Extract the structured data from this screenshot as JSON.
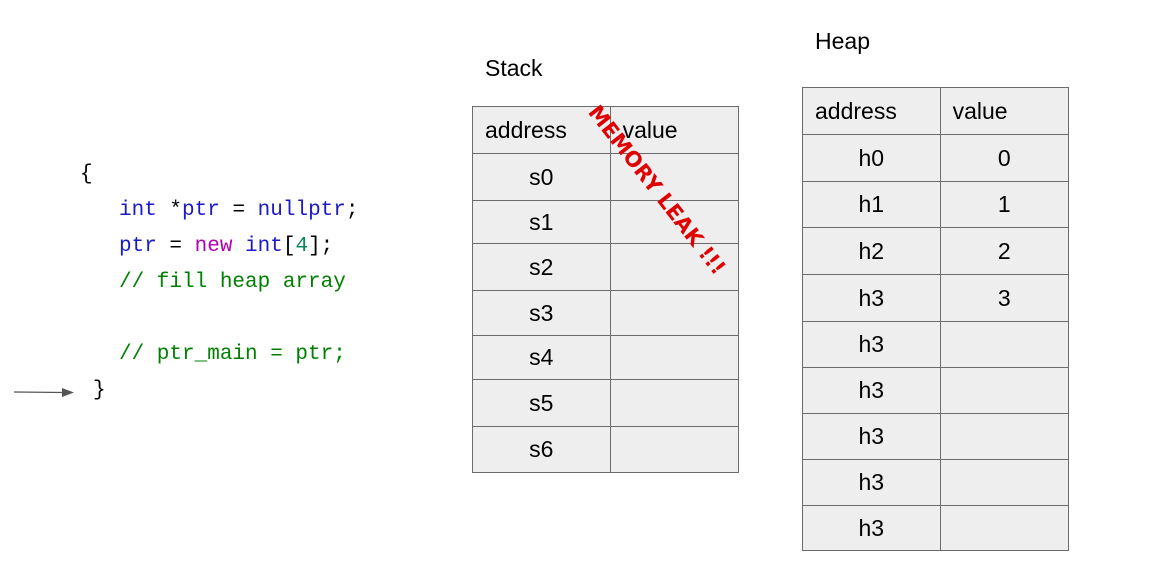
{
  "code": {
    "open_brace": "{",
    "line1": {
      "kw": "int",
      "rest1": " *",
      "ptr": "ptr",
      "rest2": " = ",
      "nullptr": "nullptr",
      "semi": ";"
    },
    "line2": {
      "ptr": "ptr",
      "eq": " = ",
      "new": "new",
      "sp": " ",
      "int": "int",
      "lb": "[",
      "num": "4",
      "rb": "];"
    },
    "line3": "// fill heap array",
    "line4": "// ptr_main = ptr;",
    "close_brace": "}"
  },
  "stack": {
    "title": "Stack",
    "header": {
      "address": "address",
      "value": "value"
    },
    "rows": [
      {
        "address": "s0",
        "value": ""
      },
      {
        "address": "s1",
        "value": ""
      },
      {
        "address": "s2",
        "value": ""
      },
      {
        "address": "s3",
        "value": ""
      },
      {
        "address": "s4",
        "value": ""
      },
      {
        "address": "s5",
        "value": ""
      },
      {
        "address": "s6",
        "value": ""
      }
    ]
  },
  "heap": {
    "title": "Heap",
    "header": {
      "address": "address",
      "value": "value"
    },
    "rows": [
      {
        "address": "h0",
        "value": "0"
      },
      {
        "address": "h1",
        "value": "1"
      },
      {
        "address": "h2",
        "value": "2"
      },
      {
        "address": "h3",
        "value": "3"
      },
      {
        "address": "h3",
        "value": ""
      },
      {
        "address": "h3",
        "value": ""
      },
      {
        "address": "h3",
        "value": ""
      },
      {
        "address": "h3",
        "value": ""
      },
      {
        "address": "h3",
        "value": ""
      }
    ]
  },
  "annotation": {
    "leak_text": "MEMORY LEAK !!!",
    "color": "#e00000"
  }
}
